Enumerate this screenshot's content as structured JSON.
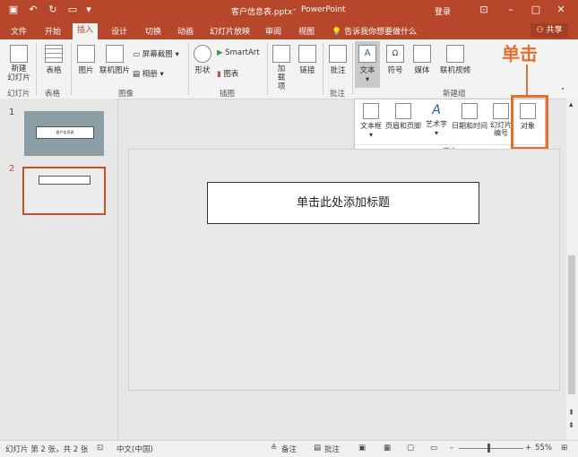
{
  "titlebar": {
    "filename": "客户信息表.pptx",
    "app": "PowerPoint",
    "login": "登录"
  },
  "tabs": [
    "文件",
    "开始",
    "插入",
    "设计",
    "切换",
    "动画",
    "幻灯片放映",
    "审阅",
    "视图"
  ],
  "tell_me": "告诉我你想要做什么",
  "share": "共享",
  "ribbon": {
    "new_slide": "新建\n幻灯片",
    "table": "表格",
    "picture": "图片",
    "online_picture": "联机图片",
    "screenshot": "屏幕截图",
    "album": "相册",
    "shapes": "形状",
    "smartart": "SmartArt",
    "chart": "图表",
    "addins": "加载项",
    "links": "链接",
    "comment": "批注",
    "text": "文本",
    "symbols": "符号",
    "media": "媒体",
    "online_video": "联机视频",
    "groups": [
      "幻灯片",
      "表格",
      "图像",
      "插图",
      "批注",
      "新建组"
    ]
  },
  "dropdown": {
    "items": [
      "文本框",
      "页眉和页脚",
      "艺术字",
      "日期和时间",
      "幻灯片\n编号",
      "对象"
    ],
    "group_label": "文本"
  },
  "callout": "单击",
  "slides": {
    "numbers": [
      "1",
      "2"
    ],
    "slide1_title": "客户信息表"
  },
  "main": {
    "placeholder": "单击此处添加标题"
  },
  "status": {
    "slide_info": "幻灯片 第 2 张，共 2 张",
    "language": "中文(中国)",
    "notes": "备注",
    "comments": "批注",
    "zoom": "55%"
  },
  "colors": {
    "accent": "#b7472a",
    "highlight": "#e27131"
  }
}
